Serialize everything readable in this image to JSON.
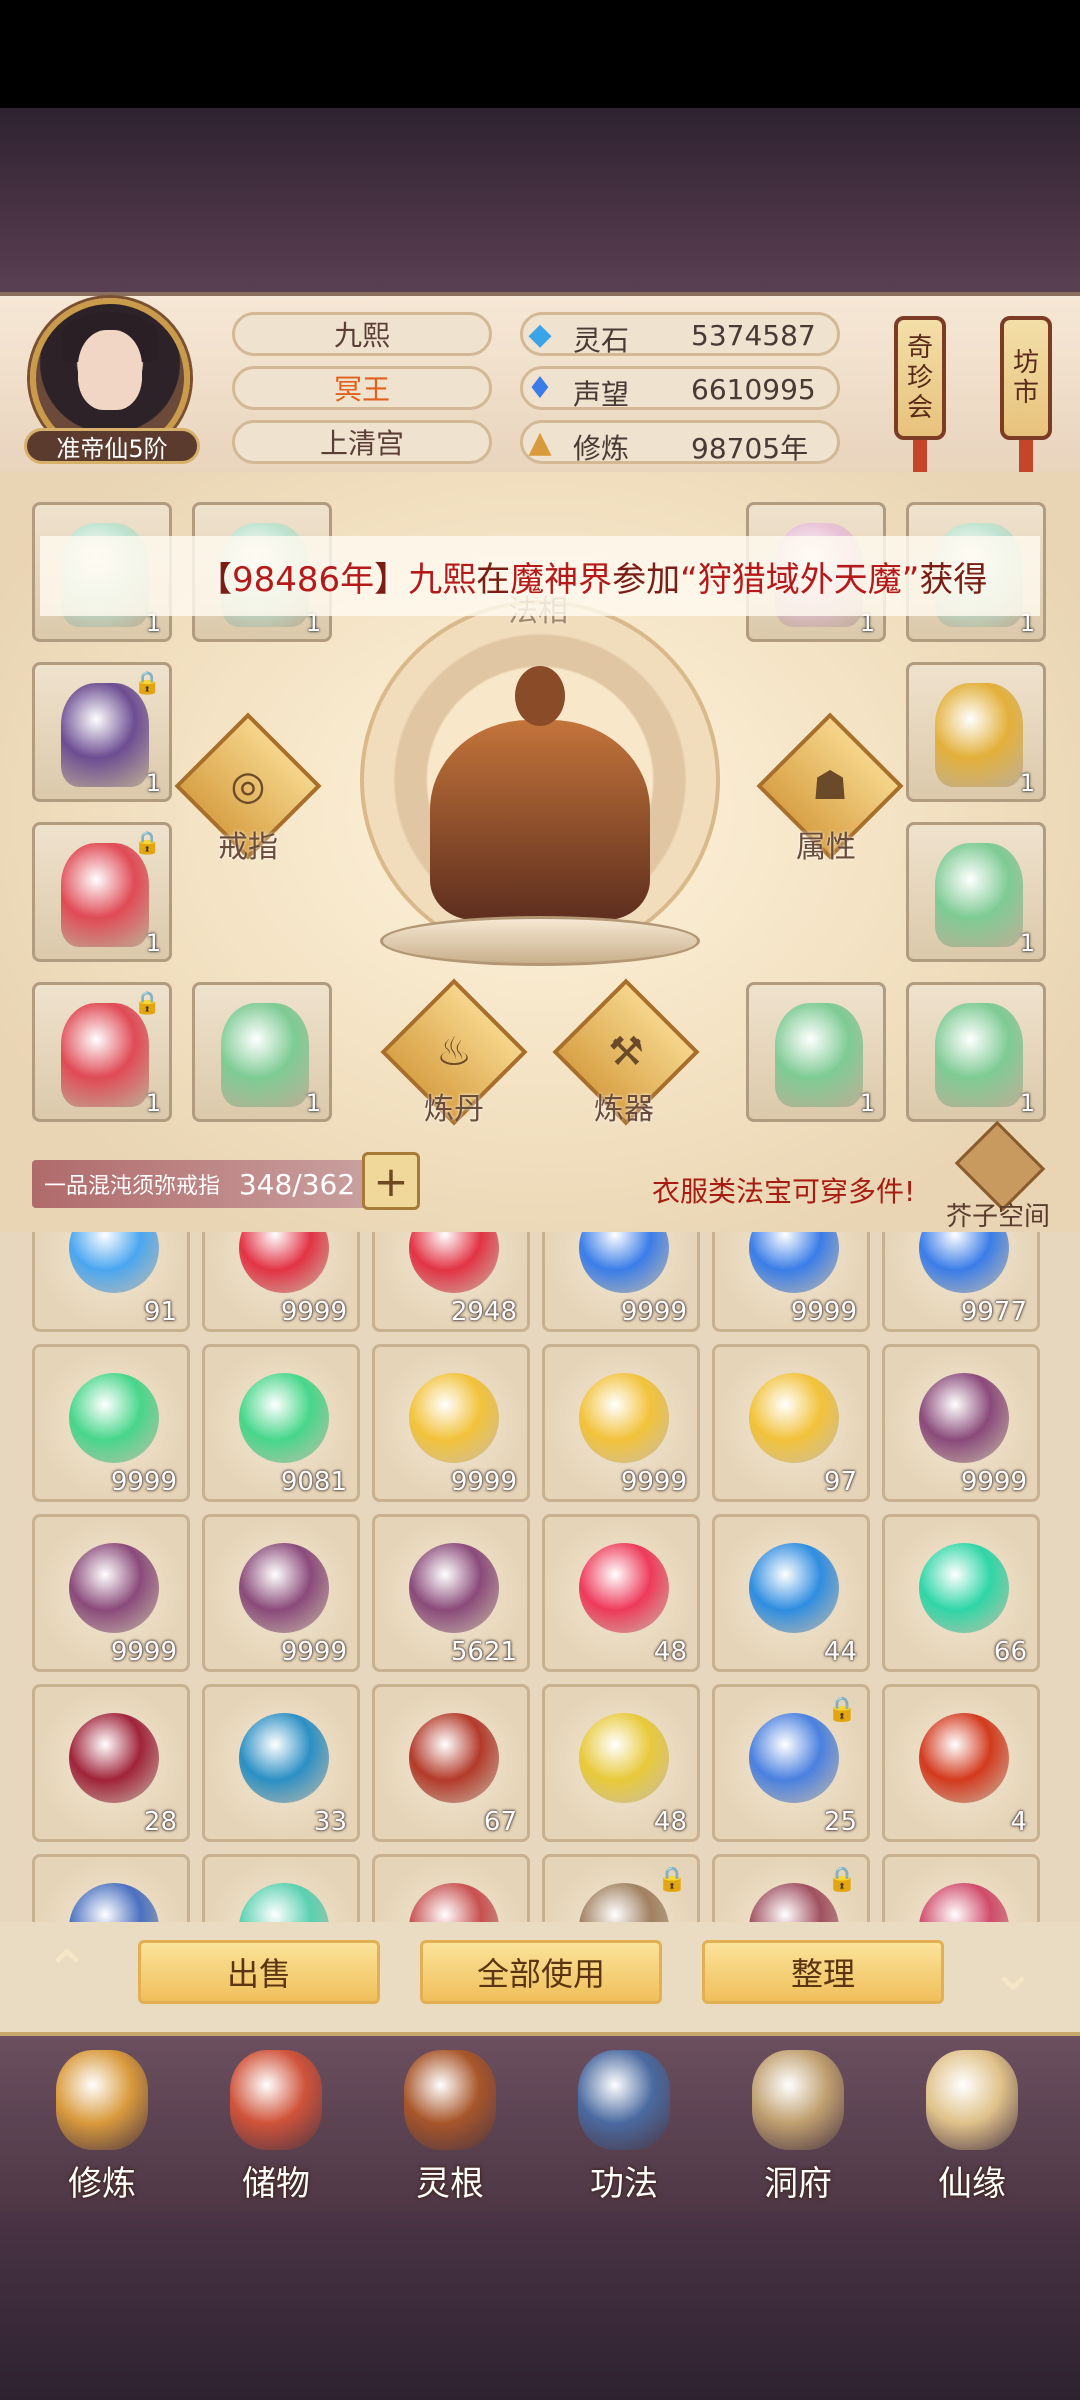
{
  "player": {
    "name": "九熙",
    "title": "冥王",
    "sect": "上清宫",
    "rank": "准帝仙5阶"
  },
  "stats": [
    {
      "label": "灵石",
      "value": "5374587",
      "icon": "spirit-stone-icon"
    },
    {
      "label": "声望",
      "value": "6610995",
      "icon": "prestige-icon"
    },
    {
      "label": "修炼",
      "value": "98705年",
      "icon": "cultivation-icon"
    }
  ],
  "lanterns": [
    {
      "label": "奇珍会"
    },
    {
      "label": "坊市"
    }
  ],
  "ticker": {
    "open": "【",
    "year": "98486年",
    "close": "】",
    "name": "九熙",
    "verb_in": "在",
    "place": "魔神界",
    "verb": "参加",
    "event": "“狩猎域外天魔”",
    "tail": "获得"
  },
  "equip_menu": {
    "ring": "戒指",
    "attributes": "属性",
    "alchemy": "炼丹",
    "forging": "炼器",
    "faxiang": "法相"
  },
  "equip_slots": [
    {
      "count": "1",
      "locked": false,
      "color": "#bfe3cf"
    },
    {
      "count": "1",
      "locked": false,
      "color": "#bfe3cf"
    },
    {
      "count": "1",
      "locked": false,
      "color": "#e9c1d6"
    },
    {
      "count": "1",
      "locked": false,
      "color": "#bfe3cf"
    },
    {
      "count": "1",
      "locked": true,
      "color": "#6c4d92"
    },
    {
      "count": "1",
      "locked": false,
      "color": "#e3b03a"
    },
    {
      "count": "1",
      "locked": true,
      "color": "#e04a55"
    },
    {
      "count": "1",
      "locked": false,
      "color": "#7ecb94"
    },
    {
      "count": "1",
      "locked": true,
      "color": "#e04a55"
    },
    {
      "count": "1",
      "locked": false,
      "color": "#7ecb94"
    },
    {
      "count": "1",
      "locked": false,
      "color": "#7ecb94"
    },
    {
      "count": "1",
      "locked": false,
      "color": "#7ecb94"
    }
  ],
  "bag": {
    "name": "一品混沌须弥戒指",
    "count": "348/362",
    "plus": "+",
    "hint": "衣服类法宝可穿多件!",
    "mustard_space": "芥子空间"
  },
  "grid_items": [
    {
      "count": "91",
      "color": "#4aa6f0",
      "locked": false
    },
    {
      "count": "9999",
      "color": "#e23344",
      "locked": false
    },
    {
      "count": "2948",
      "color": "#e23344",
      "locked": false
    },
    {
      "count": "9999",
      "color": "#3a7de8",
      "locked": false
    },
    {
      "count": "9999",
      "color": "#3a7de8",
      "locked": false
    },
    {
      "count": "9977",
      "color": "#3a7de8",
      "locked": false
    },
    {
      "count": "9999",
      "color": "#47d68a",
      "locked": false
    },
    {
      "count": "9081",
      "color": "#47d68a",
      "locked": false
    },
    {
      "count": "9999",
      "color": "#f2c23a",
      "locked": false
    },
    {
      "count": "9999",
      "color": "#f2c23a",
      "locked": false
    },
    {
      "count": "97",
      "color": "#f2c23a",
      "locked": false
    },
    {
      "count": "9999",
      "color": "#8a4a7a",
      "locked": false
    },
    {
      "count": "9999",
      "color": "#8a4a7a",
      "locked": false
    },
    {
      "count": "9999",
      "color": "#8a4a7a",
      "locked": false
    },
    {
      "count": "5621",
      "color": "#8a4a7a",
      "locked": false
    },
    {
      "count": "48",
      "color": "#ee3a5a",
      "locked": false
    },
    {
      "count": "44",
      "color": "#2f8de0",
      "locked": false
    },
    {
      "count": "66",
      "color": "#2fd6a6",
      "locked": false
    },
    {
      "count": "28",
      "color": "#a0233a",
      "locked": false
    },
    {
      "count": "33",
      "color": "#2b8fc4",
      "locked": false
    },
    {
      "count": "67",
      "color": "#b33a2a",
      "locked": false
    },
    {
      "count": "48",
      "color": "#e8c93a",
      "locked": false
    },
    {
      "count": "25",
      "color": "#4a80e0",
      "locked": true
    },
    {
      "count": "4",
      "color": "#d33a1e",
      "locked": false
    },
    {
      "count": "",
      "color": "#4a70c0",
      "locked": false
    },
    {
      "count": "",
      "color": "#5ad0b0",
      "locked": false
    },
    {
      "count": "",
      "color": "#c85050",
      "locked": false
    },
    {
      "count": "",
      "color": "#a08060",
      "locked": true
    },
    {
      "count": "",
      "color": "#a05060",
      "locked": true
    },
    {
      "count": "",
      "color": "#d04a6a",
      "locked": false
    }
  ],
  "actions": {
    "sell": "出售",
    "use_all": "全部使用",
    "sort": "整理"
  },
  "nav": [
    {
      "label": "修炼",
      "color": "#d99a3c"
    },
    {
      "label": "储物",
      "color": "#d0533a"
    },
    {
      "label": "灵根",
      "color": "#a8562a"
    },
    {
      "label": "功法",
      "color": "#4a6aa0"
    },
    {
      "label": "洞府",
      "color": "#c0a070"
    },
    {
      "label": "仙缘",
      "color": "#e0c28a"
    }
  ]
}
